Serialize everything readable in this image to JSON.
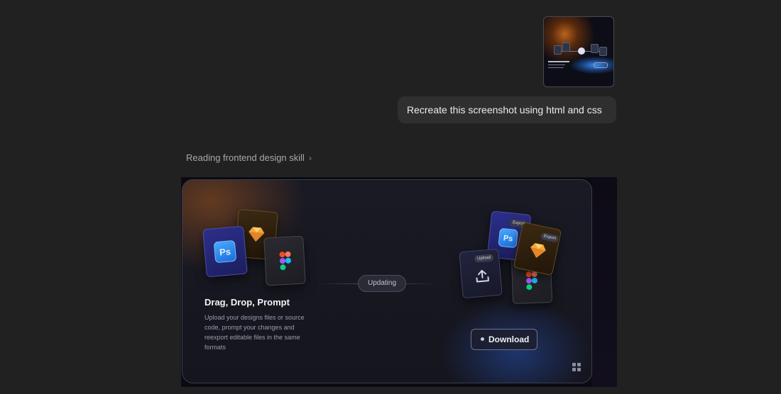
{
  "chat": {
    "user_message": "Recreate this screenshot using html and css",
    "attachment_icon": "image-thumbnail",
    "thinking_label": "Reading frontend design skill",
    "thinking_chevron": "›"
  },
  "artifact": {
    "title": "Drag, Drop, Prompt",
    "description": "Upload your designs files or source code, prompt your changes and reexport editable files in the same formats",
    "status_pill": "Updating",
    "download_label": "Download",
    "left_tiles": {
      "photoshop": "Ps",
      "sketch_icon": "sketch-icon",
      "figma_icon": "figma-icon"
    },
    "right_tiles": {
      "upload_badge": "Upload",
      "photoshop_badge": "Export",
      "photoshop": "Ps",
      "sketch_badge": "Export",
      "upload_icon": "upload-icon"
    },
    "grid_icon": "grid-icon"
  },
  "colors": {
    "background": "#212121",
    "bubble": "#2f2f2f",
    "card": "#1a1a24",
    "accent_orange": "#a0551e",
    "accent_blue": "#285ac8"
  }
}
